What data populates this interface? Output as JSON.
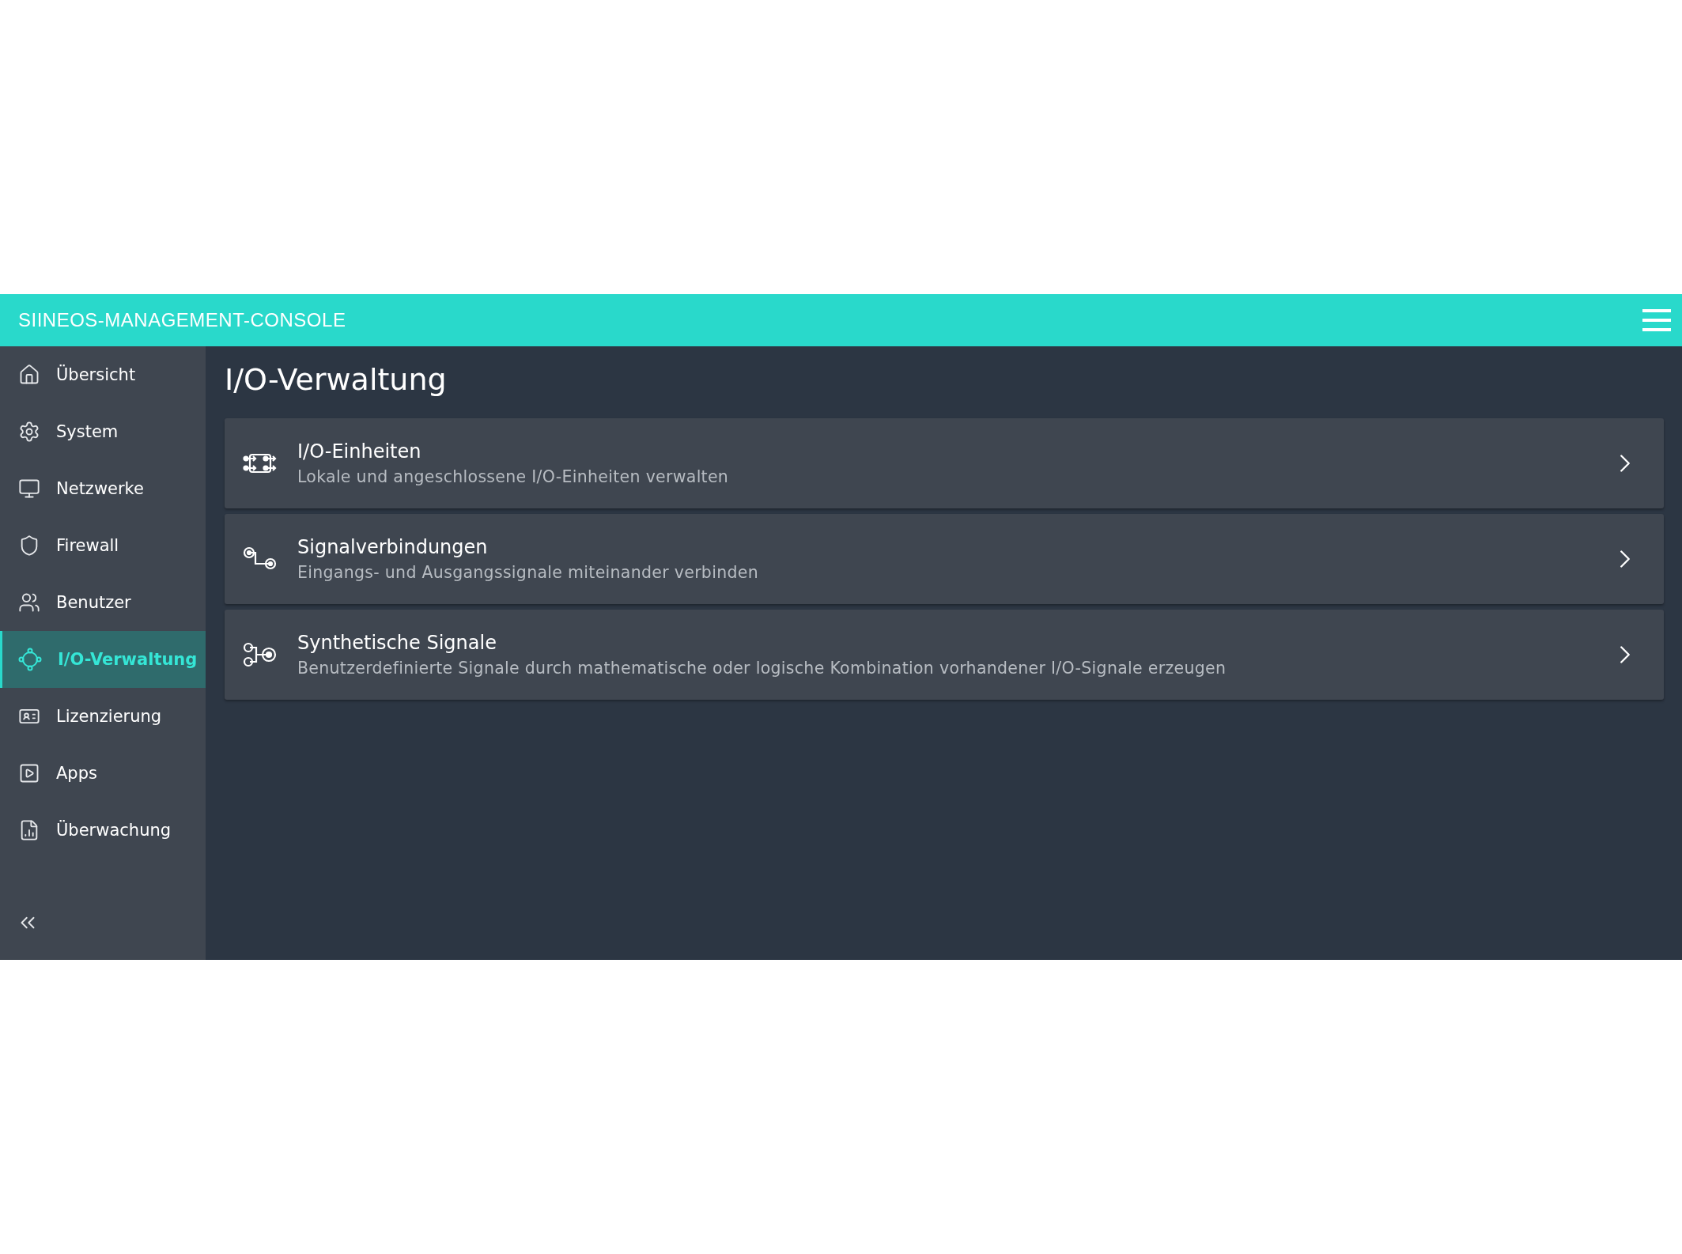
{
  "header": {
    "title": "SIINEOS-MANAGEMENT-CONSOLE"
  },
  "sidebar": {
    "items": [
      {
        "label": "Übersicht",
        "kind": "home",
        "selected": false
      },
      {
        "label": "System",
        "kind": "system",
        "selected": false
      },
      {
        "label": "Netzwerke",
        "kind": "network",
        "selected": false
      },
      {
        "label": "Firewall",
        "kind": "firewall",
        "selected": false
      },
      {
        "label": "Benutzer",
        "kind": "users",
        "selected": false
      },
      {
        "label": "I/O-Verwaltung",
        "kind": "io",
        "selected": true
      },
      {
        "label": "Lizenzierung",
        "kind": "license",
        "selected": false
      },
      {
        "label": "Apps",
        "kind": "apps",
        "selected": false
      },
      {
        "label": "Überwachung",
        "kind": "monitoring",
        "selected": false
      }
    ]
  },
  "page": {
    "title": "I/O-Verwaltung",
    "cards": [
      {
        "kind": "units",
        "title": "I/O-Einheiten",
        "description": "Lokale und angeschlossene I/O-Einheiten verwalten"
      },
      {
        "kind": "connections",
        "title": "Signalverbindungen",
        "description": "Eingangs- und Ausgangssignale miteinander verbinden"
      },
      {
        "kind": "synthetic",
        "title": "Synthetische Signale",
        "description": "Benutzerdefinierte Signale durch mathematische oder logische Kombination vorhandener I/O-Signale erzeugen"
      }
    ]
  }
}
